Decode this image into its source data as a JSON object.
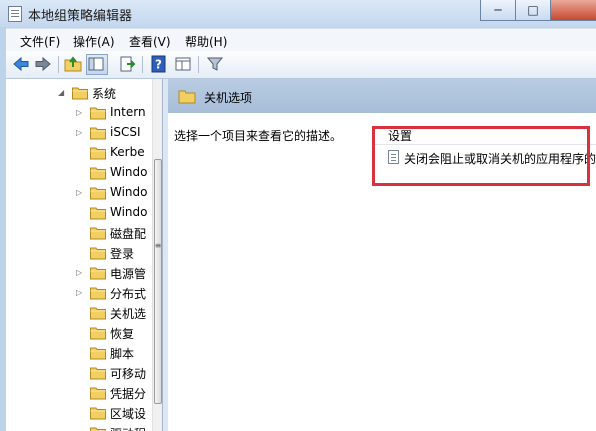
{
  "window": {
    "title": "本地组策略编辑器",
    "min_label": "─",
    "max_label": "□"
  },
  "menu": [
    {
      "label": "文件(F)"
    },
    {
      "label": "操作(A)"
    },
    {
      "label": "查看(V)"
    },
    {
      "label": "帮助(H)"
    }
  ],
  "toolbar": {
    "icons": [
      "back-arrow-icon",
      "forward-arrow-icon",
      "up-folder-icon",
      "show-hide-tree-icon",
      "export-list-icon",
      "help-icon",
      "extended-view-icon",
      "filter-icon"
    ]
  },
  "tree": {
    "items": [
      {
        "label": "系统",
        "expanded": true
      },
      {
        "label": "Intern",
        "has_children": true
      },
      {
        "label": "iSCSI",
        "has_children": true
      },
      {
        "label": "Kerbe",
        "has_children": false
      },
      {
        "label": "Windo",
        "has_children": false
      },
      {
        "label": "Windo",
        "has_children": true
      },
      {
        "label": "Windo",
        "has_children": false
      },
      {
        "label": "磁盘配",
        "has_children": false
      },
      {
        "label": "登录",
        "has_children": false
      },
      {
        "label": "电源管",
        "has_children": true
      },
      {
        "label": "分布式",
        "has_children": true
      },
      {
        "label": "关机选",
        "has_children": false,
        "selected": true
      },
      {
        "label": "恢复",
        "has_children": false
      },
      {
        "label": "脚本",
        "has_children": false
      },
      {
        "label": "可移动",
        "has_children": false
      },
      {
        "label": "凭据分",
        "has_children": false
      },
      {
        "label": "区域设",
        "has_children": false
      },
      {
        "label": "驱动程",
        "has_children": false
      }
    ]
  },
  "main": {
    "header_title": "关机选项",
    "description": "选择一个项目来查看它的描述。",
    "column_header": "设置",
    "settings": [
      {
        "label": "关闭会阻止或取消关机的应用程序的"
      }
    ]
  },
  "colors": {
    "highlight_border": "#d7323e",
    "header_bg": "#b9cce3"
  }
}
